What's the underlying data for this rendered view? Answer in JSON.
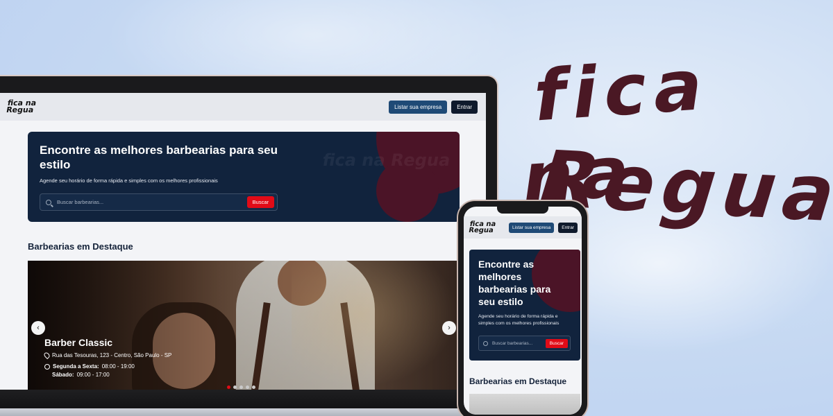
{
  "brand": {
    "line1": "fica na",
    "line2": "Regua",
    "color": "#4a1824"
  },
  "site": {
    "logo_text": "fica na Regua",
    "nav": {
      "list_business": "Listar sua empresa",
      "login": "Entrar"
    },
    "hero": {
      "title": "Encontre as melhores barbearias para seu estilo",
      "subtitle": "Agende seu horário de forma rápida e simples com os melhores profissionais",
      "search_placeholder": "Buscar barbearias...",
      "search_button": "Buscar"
    },
    "featured_title": "Barbearias em Destaque",
    "featured": {
      "name": "Barber Classic",
      "address": "Rua das Tesouras, 123 - Centro, São Paulo - SP",
      "weekdays_label": "Segunda a Sexta:",
      "weekdays_hours": "08:00 - 19:00",
      "saturday_label": "Sábado:",
      "saturday_hours": "09:00 - 17:00"
    },
    "carousel": {
      "prev": "‹",
      "next": "›",
      "slides": 5,
      "active": 1
    },
    "colors": {
      "accent": "#e10b17",
      "hero_bg": "#11233d",
      "hero_circle": "#4b1427",
      "nav_button": "#1f4a76"
    }
  }
}
